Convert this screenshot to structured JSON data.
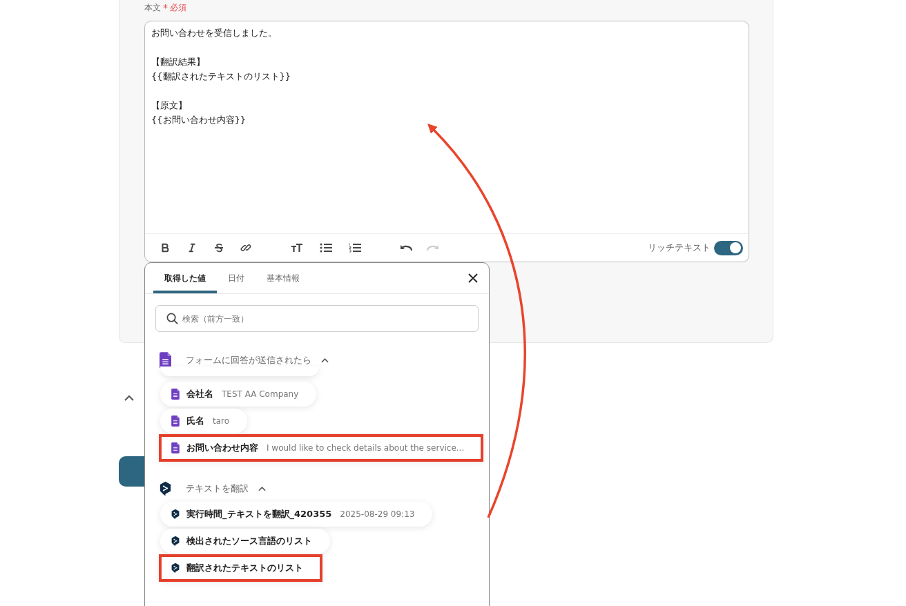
{
  "field": {
    "label": "本文",
    "required_mark": "*",
    "required_text": "必須"
  },
  "editor": {
    "paragraphs": [
      [
        "お問い合わせを受信しました。"
      ],
      [
        "【翻訳結果】",
        "{{翻訳されたテキストのリスト}}"
      ],
      [
        "【原文】",
        "{{お問い合わせ内容}}"
      ]
    ],
    "toolbar": [
      {
        "kind": "bold",
        "disabled": false
      },
      {
        "kind": "italic",
        "disabled": false
      },
      {
        "kind": "strike",
        "disabled": false
      },
      {
        "kind": "link",
        "disabled": false
      },
      {
        "kind": "heading",
        "disabled": false
      },
      {
        "kind": "bullet",
        "disabled": false
      },
      {
        "kind": "numbered",
        "disabled": false
      },
      {
        "kind": "undo",
        "disabled": false
      },
      {
        "kind": "redo",
        "disabled": true
      }
    ],
    "rich_text": {
      "label": "リッチテキスト",
      "on": true
    }
  },
  "section": {
    "expanded": true
  },
  "picker": {
    "tabs": [
      {
        "label": "取得した値",
        "selected": true
      },
      {
        "label": "日付",
        "selected": false
      },
      {
        "label": "基本情報",
        "selected": false
      }
    ],
    "search": {
      "placeholder": "検索（前方一致）"
    },
    "groups": [
      {
        "kind": "form",
        "title": "フォームに回答が送信されたら",
        "expanded": true,
        "items": [
          {
            "name": "会社名",
            "value": "TEST AA Company",
            "highlighted": false
          },
          {
            "name": "氏名",
            "value": "taro",
            "highlighted": false
          },
          {
            "name": "お問い合わせ内容",
            "value": "I would like to check details about the service...",
            "highlighted": true
          }
        ]
      },
      {
        "kind": "translate",
        "title": "テキストを翻訳",
        "expanded": true,
        "items": [
          {
            "name": "実行時間_テキストを翻訳_420355",
            "value": "2025-08-29 09:13",
            "highlighted": false
          },
          {
            "name": "検出されたソース言語のリスト",
            "highlighted": false
          },
          {
            "name": "翻訳されたテキストのリスト",
            "highlighted": true
          }
        ]
      }
    ]
  }
}
